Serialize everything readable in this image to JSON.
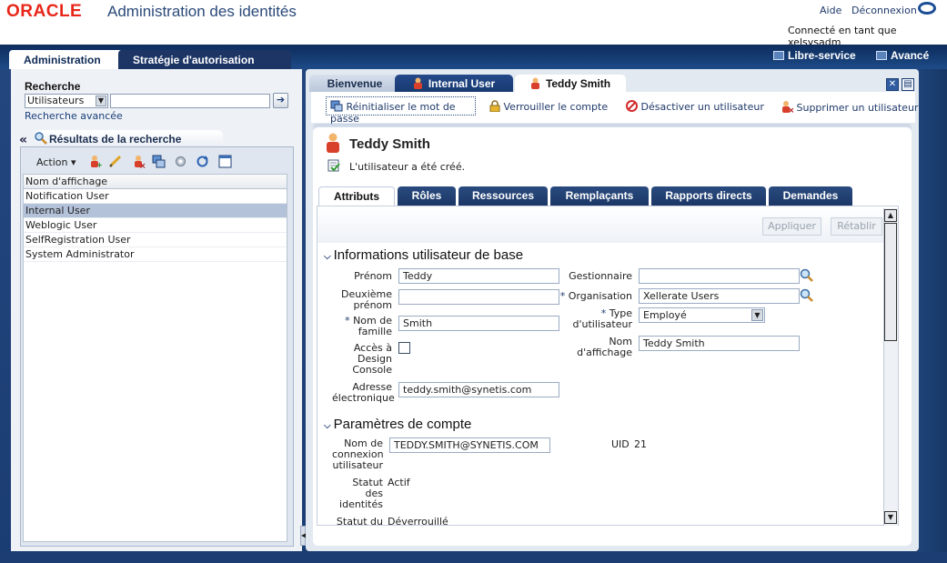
{
  "header": {
    "logo": "ORACLE",
    "title": "Administration des identités",
    "help": "Aide",
    "logout": "Déconnexion",
    "connected": "Connecté en tant que xelsysadm"
  },
  "top_tabs": {
    "admin": "Administration",
    "strategy": "Stratégie d'autorisation",
    "self_service": "Libre-service",
    "advanced": "Avancé"
  },
  "search": {
    "title": "Recherche",
    "scope": "Utilisateurs",
    "advanced": "Recherche avancée",
    "results_tab": "Résultats de la recherche",
    "action": "Action",
    "column": "Nom d'affichage",
    "rows": [
      "Notification User",
      "Internal User",
      "Weblogic User",
      "SelfRegistration User",
      "System Administrator"
    ]
  },
  "right_tabs": {
    "welcome": "Bienvenue",
    "internal": "Internal User",
    "teddy": "Teddy Smith"
  },
  "actions": {
    "reset": "Réinitialiser le mot de passe",
    "lock": "Verrouiller le compte",
    "disable": "Désactiver un utilisateur",
    "delete": "Supprimer un utilisateur"
  },
  "user": {
    "name": "Teddy Smith",
    "message": "L'utilisateur a été créé."
  },
  "inner_tabs": [
    "Attributs",
    "Rôles",
    "Ressources",
    "Remplaçants",
    "Rapports directs",
    "Demandes"
  ],
  "buttons": {
    "apply": "Appliquer",
    "reset": "Rétablir"
  },
  "basic_info": {
    "heading": "Informations utilisateur de base",
    "first_name_label": "Prénom",
    "first_name": "Teddy",
    "middle_name_label": "Deuxième prénom",
    "last_name_label": "Nom de famille",
    "last_name": "Smith",
    "design_console_label": "Accès à Design Console",
    "email_label": "Adresse électronique",
    "email": "teddy.smith@synetis.com",
    "manager_label": "Gestionnaire",
    "organisation_label": "Organisation",
    "organisation": "Xellerate Users",
    "user_type_label": "Type d'utilisateur",
    "user_type": "Employé",
    "display_name_label": "Nom d'affichage",
    "display_name": "Teddy Smith",
    "required_mark": "*"
  },
  "account": {
    "heading": "Paramètres de compte",
    "login_label": "Nom de connexion utilisateur",
    "login": "TEDDY.SMITH@SYNETIS.COM",
    "uid_label": "UID",
    "uid": "21",
    "identity_status_label": "Statut des identités",
    "identity_status": "Actif",
    "status_label": "Statut du",
    "status": "Déverrouillé"
  }
}
